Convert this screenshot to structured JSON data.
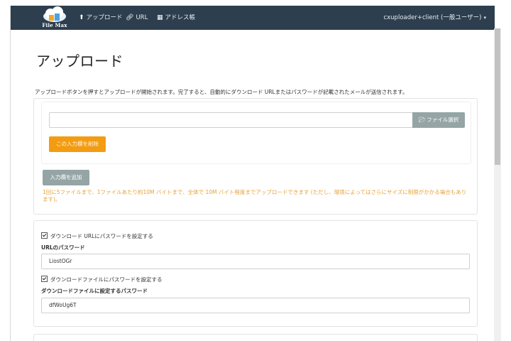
{
  "navbar": {
    "logo_text": "File Max",
    "items": [
      {
        "label": "アップロード",
        "icon": "upload-icon"
      },
      {
        "label": "URL",
        "icon": "link-icon"
      },
      {
        "label": "アドレス帳",
        "icon": "address-book-icon"
      }
    ],
    "user_label": "cxuploader+client (一般ユーザー)"
  },
  "page": {
    "title": "アップロード",
    "intro": "アップロードボタンを押すとアップロードが開始されます。完了すると、自動的にダウンロード URLまたはパスワードが記載されたメールが送信されます。"
  },
  "upload": {
    "file_select_label": "ファイル選択",
    "clear_label": "この入力欄を削除",
    "add_field_label": "入力欄を追加",
    "limit_note": "1回に5ファイルまで、1ファイルあたり約10M バイトまで、全体で 10M バイト程度までアップロードできます (ただし、環境によってはさらにサイズに制限がかかる場合もあります)。"
  },
  "password": {
    "url_pw_check_label": "ダウンロード URLにパスワードを設定する",
    "url_pw_label": "URLのパスワード",
    "url_pw_value": "LiostOGr",
    "file_pw_check_label": "ダウンロードファイルにパスワードを設定する",
    "file_pw_label": "ダウンロードファイルに設定するパスワード",
    "file_pw_value": "dfWoUg6T"
  },
  "colors": {
    "navbar": "#2d3e4e",
    "accent_orange": "#f39c12",
    "button_gray": "#95a5a6",
    "note_text": "#e6a23c"
  }
}
